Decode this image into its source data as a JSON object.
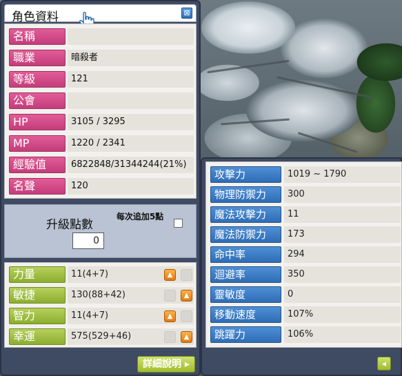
{
  "character_window": {
    "title": "角色資料",
    "close_icon_glyph": "⊠",
    "info_rows": [
      {
        "label": "名稱",
        "value": ""
      },
      {
        "label": "職業",
        "value": "暗殺者"
      },
      {
        "label": "等級",
        "value": "121"
      },
      {
        "label": "公會",
        "value": ""
      },
      {
        "label": "HP",
        "value": "3105 / 3295"
      },
      {
        "label": "MP",
        "value": "1220 / 2341"
      },
      {
        "label": "經驗值",
        "value": "6822848/31344244(21%)"
      },
      {
        "label": "名聲",
        "value": "120"
      }
    ],
    "ability_points": {
      "label": "升級點數",
      "value": "0",
      "auto_assign_label": "每次追加5點",
      "auto_assign_checked": false
    },
    "stats": [
      {
        "label": "力量",
        "value": "11(4+7)",
        "up_enabled": true
      },
      {
        "label": "敏捷",
        "value": "130(88+42)",
        "up_enabled": true
      },
      {
        "label": "智力",
        "value": "11(4+7)",
        "up_enabled": true
      },
      {
        "label": "幸運",
        "value": "575(529+46)",
        "up_enabled": true
      }
    ],
    "detail_button_label": "詳細說明 ▸"
  },
  "detail_window": {
    "rows": [
      {
        "label": "攻擊力",
        "value": "1019 ~ 1790"
      },
      {
        "label": "物理防禦力",
        "value": "300"
      },
      {
        "label": "魔法攻擊力",
        "value": "11"
      },
      {
        "label": "魔法防禦力",
        "value": "173"
      },
      {
        "label": "命中率",
        "value": "294"
      },
      {
        "label": "迴避率",
        "value": "350"
      },
      {
        "label": "靈敏度",
        "value": "0"
      },
      {
        "label": "移動速度",
        "value": "107%"
      },
      {
        "label": "跳躍力",
        "value": "106%"
      }
    ],
    "back_button_glyph": "◂"
  },
  "colors": {
    "info_label": "#d44b8a",
    "stat_label": "#9dbd3d",
    "detail_label": "#3f7ec6",
    "window_frame": "#3f4a63"
  }
}
